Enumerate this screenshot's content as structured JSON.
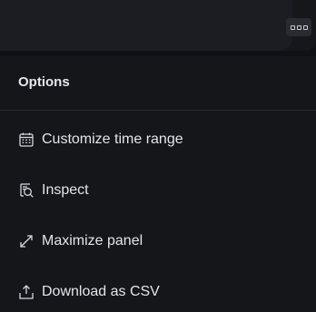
{
  "menu": {
    "title": "Options",
    "items": [
      {
        "label": "Customize time range",
        "icon": "calendar-icon"
      },
      {
        "label": "Inspect",
        "icon": "inspect-icon"
      },
      {
        "label": "Maximize panel",
        "icon": "maximize-icon"
      },
      {
        "label": "Download as CSV",
        "icon": "download-icon"
      }
    ]
  },
  "colors": {
    "background": "#101114",
    "menu_background": "#15161a",
    "text": "#e4e5ea",
    "divider": "#2a2b31"
  }
}
